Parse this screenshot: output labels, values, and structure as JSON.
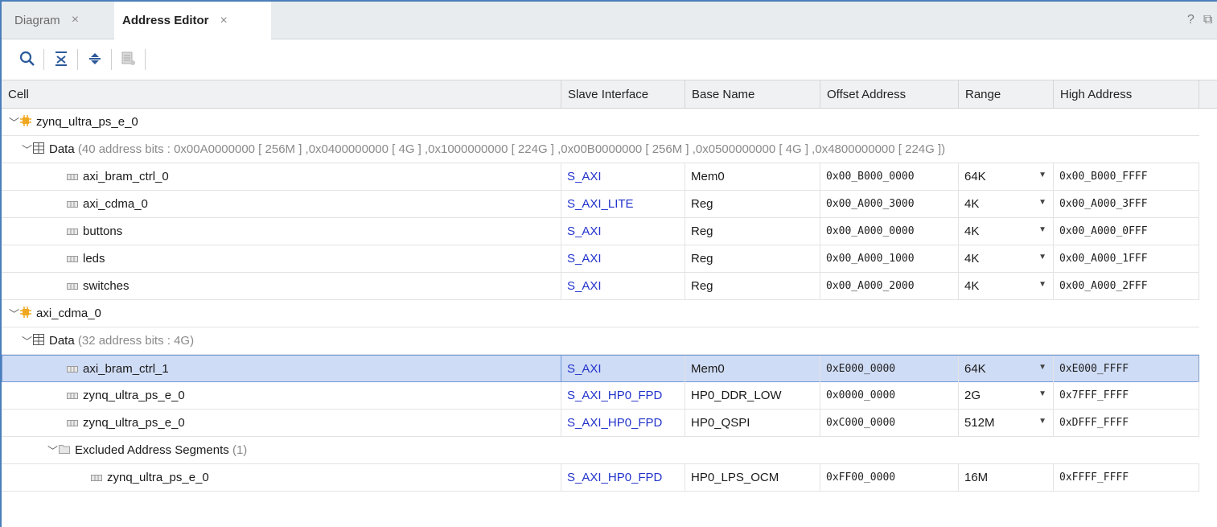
{
  "tabs": [
    {
      "label": "Diagram",
      "close": "×"
    },
    {
      "label": "Address Editor",
      "close": "×"
    }
  ],
  "window_controls": {
    "help": "?",
    "restore": "⧉"
  },
  "toolbar": {
    "icons": [
      "search-icon",
      "collapse-all-icon",
      "expand-all-icon",
      "auto-assign-icon"
    ]
  },
  "columns": [
    "Cell",
    "Slave Interface",
    "Base Name",
    "Offset Address",
    "Range",
    "High Address"
  ],
  "rows": {
    "r0": {
      "cell": "zynq_ultra_ps_e_0"
    },
    "r1": {
      "label": "Data",
      "detail": "(40 address bits : 0x00A0000000 [ 256M ] ,0x0400000000 [ 4G ] ,0x1000000000 [ 224G ] ,0x00B0000000 [ 256M ] ,0x0500000000 [ 4G ] ,0x4800000000 [ 224G ])"
    },
    "r2": {
      "cell": "axi_bram_ctrl_0",
      "slave": "S_AXI",
      "base": "Mem0",
      "offset": "0x00_B000_0000",
      "range": "64K",
      "high": "0x00_B000_FFFF"
    },
    "r3": {
      "cell": "axi_cdma_0",
      "slave": "S_AXI_LITE",
      "base": "Reg",
      "offset": "0x00_A000_3000",
      "range": "4K",
      "high": "0x00_A000_3FFF"
    },
    "r4": {
      "cell": "buttons",
      "slave": "S_AXI",
      "base": "Reg",
      "offset": "0x00_A000_0000",
      "range": "4K",
      "high": "0x00_A000_0FFF"
    },
    "r5": {
      "cell": "leds",
      "slave": "S_AXI",
      "base": "Reg",
      "offset": "0x00_A000_1000",
      "range": "4K",
      "high": "0x00_A000_1FFF"
    },
    "r6": {
      "cell": "switches",
      "slave": "S_AXI",
      "base": "Reg",
      "offset": "0x00_A000_2000",
      "range": "4K",
      "high": "0x00_A000_2FFF"
    },
    "r7": {
      "cell": "axi_cdma_0"
    },
    "r8": {
      "label": "Data",
      "detail": "(32 address bits : 4G)"
    },
    "r9": {
      "cell": "axi_bram_ctrl_1",
      "slave": "S_AXI",
      "base": "Mem0",
      "offset": "0xE000_0000",
      "range": "64K",
      "high": "0xE000_FFFF"
    },
    "r10": {
      "cell": "zynq_ultra_ps_e_0",
      "slave": "S_AXI_HP0_FPD",
      "base": "HP0_DDR_LOW",
      "offset": "0x0000_0000",
      "range": "2G",
      "high": "0x7FFF_FFFF"
    },
    "r11": {
      "cell": "zynq_ultra_ps_e_0",
      "slave": "S_AXI_HP0_FPD",
      "base": "HP0_QSPI",
      "offset": "0xC000_0000",
      "range": "512M",
      "high": "0xDFFF_FFFF"
    },
    "r12": {
      "label": "Excluded Address Segments",
      "detail": "(1)"
    },
    "r13": {
      "cell": "zynq_ultra_ps_e_0",
      "slave": "S_AXI_HP0_FPD",
      "base": "HP0_LPS_OCM",
      "offset": "0xFF00_0000",
      "range": "16M",
      "high": "0xFFFF_FFFF"
    }
  },
  "colors": {
    "selection": "#cfdcf5",
    "link": "#2233cc",
    "frame_accent": "#4a7ebb"
  }
}
